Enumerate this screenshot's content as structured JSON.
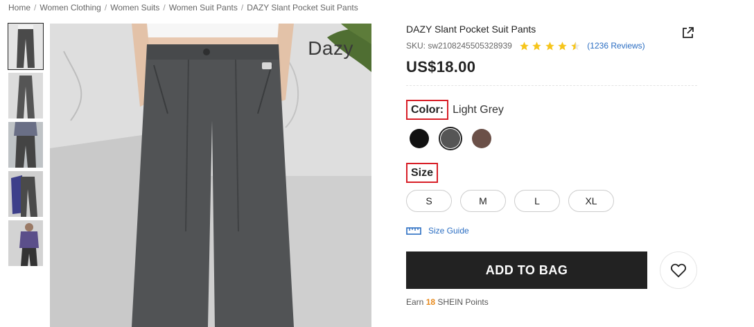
{
  "breadcrumb": [
    "Home",
    "Women Clothing",
    "Women Suits",
    "Women Suit Pants",
    "DAZY Slant Pocket Suit Pants"
  ],
  "gallery": {
    "watermark": "Dazy",
    "thumbnail_count": 5
  },
  "product": {
    "title": "DAZY Slant Pocket Suit Pants",
    "sku": "SKU: sw2108245505328939",
    "rating": 4.5,
    "reviews": "(1236 Reviews)",
    "price": "US$18.00"
  },
  "color": {
    "label": "Color:",
    "selected": "Light Grey",
    "options": [
      {
        "name": "Black",
        "hex": "#111111"
      },
      {
        "name": "Light Grey",
        "hex": "#555555"
      },
      {
        "name": "Brown",
        "hex": "#6b5048"
      }
    ],
    "selected_index": 1
  },
  "size": {
    "label": "Size",
    "options": [
      "S",
      "M",
      "L",
      "XL"
    ]
  },
  "size_guide": "Size Guide",
  "add_to_bag": "ADD TO BAG",
  "points": {
    "prefix": "Earn",
    "value": "18",
    "suffix": "SHEIN Points"
  },
  "icons": {
    "share": "share-icon",
    "star": "star-icon",
    "ruler": "ruler-icon",
    "wishlist": "heart-icon"
  },
  "colors": {
    "accent_link": "#2a6dc2",
    "star": "#f6c51b",
    "highlight_box": "#d81e27",
    "button_bg": "#222222",
    "points": "#e78a1d"
  }
}
